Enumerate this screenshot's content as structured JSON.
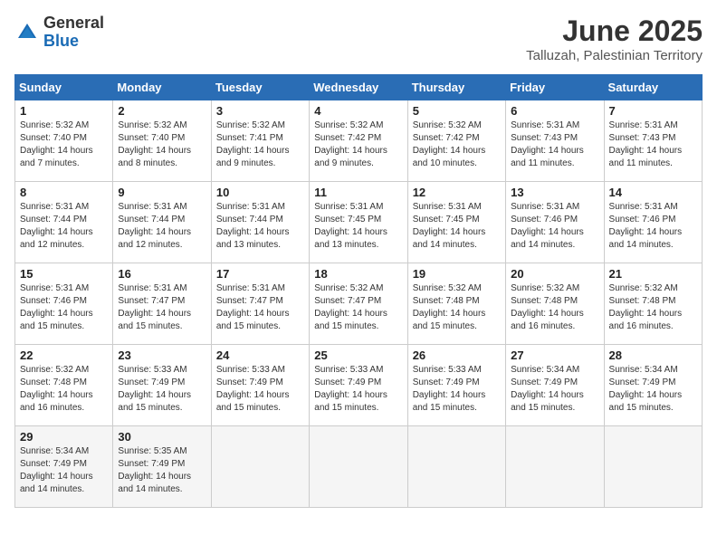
{
  "header": {
    "logo_general": "General",
    "logo_blue": "Blue",
    "month_year": "June 2025",
    "location": "Talluzah, Palestinian Territory"
  },
  "days_of_week": [
    "Sunday",
    "Monday",
    "Tuesday",
    "Wednesday",
    "Thursday",
    "Friday",
    "Saturday"
  ],
  "weeks": [
    [
      {
        "day": "1",
        "info": "Sunrise: 5:32 AM\nSunset: 7:40 PM\nDaylight: 14 hours\nand 7 minutes."
      },
      {
        "day": "2",
        "info": "Sunrise: 5:32 AM\nSunset: 7:40 PM\nDaylight: 14 hours\nand 8 minutes."
      },
      {
        "day": "3",
        "info": "Sunrise: 5:32 AM\nSunset: 7:41 PM\nDaylight: 14 hours\nand 9 minutes."
      },
      {
        "day": "4",
        "info": "Sunrise: 5:32 AM\nSunset: 7:42 PM\nDaylight: 14 hours\nand 9 minutes."
      },
      {
        "day": "5",
        "info": "Sunrise: 5:32 AM\nSunset: 7:42 PM\nDaylight: 14 hours\nand 10 minutes."
      },
      {
        "day": "6",
        "info": "Sunrise: 5:31 AM\nSunset: 7:43 PM\nDaylight: 14 hours\nand 11 minutes."
      },
      {
        "day": "7",
        "info": "Sunrise: 5:31 AM\nSunset: 7:43 PM\nDaylight: 14 hours\nand 11 minutes."
      }
    ],
    [
      {
        "day": "8",
        "info": "Sunrise: 5:31 AM\nSunset: 7:44 PM\nDaylight: 14 hours\nand 12 minutes."
      },
      {
        "day": "9",
        "info": "Sunrise: 5:31 AM\nSunset: 7:44 PM\nDaylight: 14 hours\nand 12 minutes."
      },
      {
        "day": "10",
        "info": "Sunrise: 5:31 AM\nSunset: 7:44 PM\nDaylight: 14 hours\nand 13 minutes."
      },
      {
        "day": "11",
        "info": "Sunrise: 5:31 AM\nSunset: 7:45 PM\nDaylight: 14 hours\nand 13 minutes."
      },
      {
        "day": "12",
        "info": "Sunrise: 5:31 AM\nSunset: 7:45 PM\nDaylight: 14 hours\nand 14 minutes."
      },
      {
        "day": "13",
        "info": "Sunrise: 5:31 AM\nSunset: 7:46 PM\nDaylight: 14 hours\nand 14 minutes."
      },
      {
        "day": "14",
        "info": "Sunrise: 5:31 AM\nSunset: 7:46 PM\nDaylight: 14 hours\nand 14 minutes."
      }
    ],
    [
      {
        "day": "15",
        "info": "Sunrise: 5:31 AM\nSunset: 7:46 PM\nDaylight: 14 hours\nand 15 minutes."
      },
      {
        "day": "16",
        "info": "Sunrise: 5:31 AM\nSunset: 7:47 PM\nDaylight: 14 hours\nand 15 minutes."
      },
      {
        "day": "17",
        "info": "Sunrise: 5:31 AM\nSunset: 7:47 PM\nDaylight: 14 hours\nand 15 minutes."
      },
      {
        "day": "18",
        "info": "Sunrise: 5:32 AM\nSunset: 7:47 PM\nDaylight: 14 hours\nand 15 minutes."
      },
      {
        "day": "19",
        "info": "Sunrise: 5:32 AM\nSunset: 7:48 PM\nDaylight: 14 hours\nand 15 minutes."
      },
      {
        "day": "20",
        "info": "Sunrise: 5:32 AM\nSunset: 7:48 PM\nDaylight: 14 hours\nand 16 minutes."
      },
      {
        "day": "21",
        "info": "Sunrise: 5:32 AM\nSunset: 7:48 PM\nDaylight: 14 hours\nand 16 minutes."
      }
    ],
    [
      {
        "day": "22",
        "info": "Sunrise: 5:32 AM\nSunset: 7:48 PM\nDaylight: 14 hours\nand 16 minutes."
      },
      {
        "day": "23",
        "info": "Sunrise: 5:33 AM\nSunset: 7:49 PM\nDaylight: 14 hours\nand 15 minutes."
      },
      {
        "day": "24",
        "info": "Sunrise: 5:33 AM\nSunset: 7:49 PM\nDaylight: 14 hours\nand 15 minutes."
      },
      {
        "day": "25",
        "info": "Sunrise: 5:33 AM\nSunset: 7:49 PM\nDaylight: 14 hours\nand 15 minutes."
      },
      {
        "day": "26",
        "info": "Sunrise: 5:33 AM\nSunset: 7:49 PM\nDaylight: 14 hours\nand 15 minutes."
      },
      {
        "day": "27",
        "info": "Sunrise: 5:34 AM\nSunset: 7:49 PM\nDaylight: 14 hours\nand 15 minutes."
      },
      {
        "day": "28",
        "info": "Sunrise: 5:34 AM\nSunset: 7:49 PM\nDaylight: 14 hours\nand 15 minutes."
      }
    ],
    [
      {
        "day": "29",
        "info": "Sunrise: 5:34 AM\nSunset: 7:49 PM\nDaylight: 14 hours\nand 14 minutes."
      },
      {
        "day": "30",
        "info": "Sunrise: 5:35 AM\nSunset: 7:49 PM\nDaylight: 14 hours\nand 14 minutes."
      },
      {
        "day": "",
        "info": ""
      },
      {
        "day": "",
        "info": ""
      },
      {
        "day": "",
        "info": ""
      },
      {
        "day": "",
        "info": ""
      },
      {
        "day": "",
        "info": ""
      }
    ]
  ]
}
